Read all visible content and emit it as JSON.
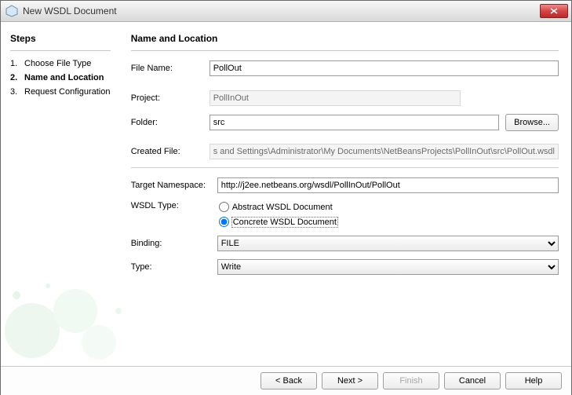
{
  "window": {
    "title": "New WSDL Document"
  },
  "sidebar": {
    "heading": "Steps",
    "steps": [
      {
        "num": "1.",
        "label": "Choose File Type"
      },
      {
        "num": "2.",
        "label": "Name and Location"
      },
      {
        "num": "3.",
        "label": "Request Configuration"
      }
    ]
  },
  "main": {
    "heading": "Name and Location",
    "file_name_label": "File Name:",
    "file_name_value": "PollOut",
    "project_label": "Project:",
    "project_value": "PollInOut",
    "folder_label": "Folder:",
    "folder_value": "src",
    "browse_label": "Browse...",
    "created_label": "Created File:",
    "created_value": "s and Settings\\Administrator\\My Documents\\NetBeansProjects\\PollInOut\\src\\PollOut.wsdl",
    "target_ns_label": "Target Namespace:",
    "target_ns_value": "http://j2ee.netbeans.org/wsdl/PollInOut/PollOut",
    "wsdl_type_label": "WSDL Type:",
    "wsdl_type_abstract": "Abstract WSDL Document",
    "wsdl_type_concrete": "Concrete WSDL Document",
    "binding_label": "Binding:",
    "binding_value": "FILE",
    "type_label": "Type:",
    "type_value": "Write"
  },
  "footer": {
    "back": "< Back",
    "next": "Next >",
    "finish": "Finish",
    "cancel": "Cancel",
    "help": "Help"
  }
}
